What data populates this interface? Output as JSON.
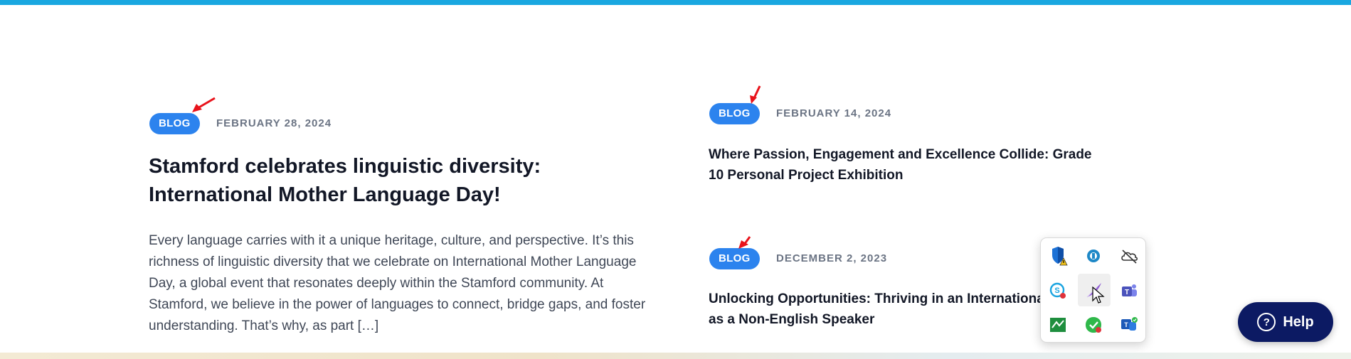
{
  "posts": {
    "featured": {
      "badge": "BLOG",
      "date": "FEBRUARY 28, 2024",
      "title": "Stamford celebrates linguistic diversity: International Mother Language Day!",
      "excerpt": "Every language carries with it a unique heritage, culture, and perspective. It’s this richness of linguistic diversity that we celebrate on International Mother Language Day, a global event that resonates deeply within the Stamford community. At Stamford, we believe in the power of languages to connect, bridge gaps, and foster understanding. That’s why, as part […]"
    },
    "side": [
      {
        "badge": "BLOG",
        "date": "FEBRUARY 14, 2024",
        "title": "Where Passion, Engagement and Excellence Collide: Grade 10 Personal Project Exhibition"
      },
      {
        "badge": "BLOG",
        "date": "DECEMBER 2, 2023",
        "title": "Unlocking Opportunities: Thriving in an International School as a Non-English Speaker"
      }
    ]
  },
  "help_button": {
    "icon_glyph": "?",
    "label": "Help"
  },
  "system_tray": {
    "icons": [
      "defender-shield-warning-icon",
      "cloud-sync-icon",
      "onedrive-offline-icon",
      "skype-icon",
      "feather-pen-icon",
      "teams-icon",
      "green-app-icon",
      "check-badge-icon",
      "teams-new-icon"
    ]
  },
  "colors": {
    "accent": "#19a7e0",
    "badge": "#2c83ee",
    "help_button": "#0c1a63",
    "annotation_arrow": "#e8131b"
  }
}
